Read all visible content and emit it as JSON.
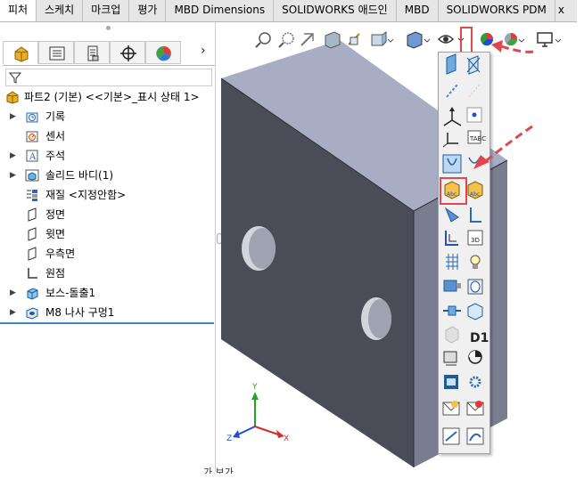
{
  "tabs": [
    "피처",
    "스케치",
    "마크업",
    "평가",
    "MBD Dimensions",
    "SOLIDWORKS 애드인",
    "MBD",
    "SOLIDWORKS PDM",
    "x"
  ],
  "active_tab": 0,
  "panel": {
    "more_icon": "›",
    "part_title": "파트2 (기본) <<기본>_표시 상태 1>",
    "tree": [
      {
        "label": "기록",
        "icon": "history-icon",
        "expand": true
      },
      {
        "label": "센서",
        "icon": "sensor-icon",
        "expand": false
      },
      {
        "label": "주석",
        "icon": "annotation-icon",
        "expand": true
      },
      {
        "label": "솔리드 바디(1)",
        "icon": "solid-body-icon",
        "expand": true
      },
      {
        "label": "재질 <지정안함>",
        "icon": "material-icon",
        "expand": false
      },
      {
        "label": "정면",
        "icon": "plane-icon",
        "expand": false
      },
      {
        "label": "윗면",
        "icon": "plane-icon",
        "expand": false
      },
      {
        "label": "우측면",
        "icon": "plane-icon",
        "expand": false
      },
      {
        "label": "원점",
        "icon": "origin-icon",
        "expand": false
      },
      {
        "label": "보스-돌출1",
        "icon": "extrude-icon",
        "expand": true
      },
      {
        "label": "M8 나사 구멍1",
        "icon": "hole-wizard-icon",
        "expand": true
      }
    ]
  },
  "palette": {
    "text_d1": "D1"
  },
  "bottom_cut_text": "가 보가"
}
